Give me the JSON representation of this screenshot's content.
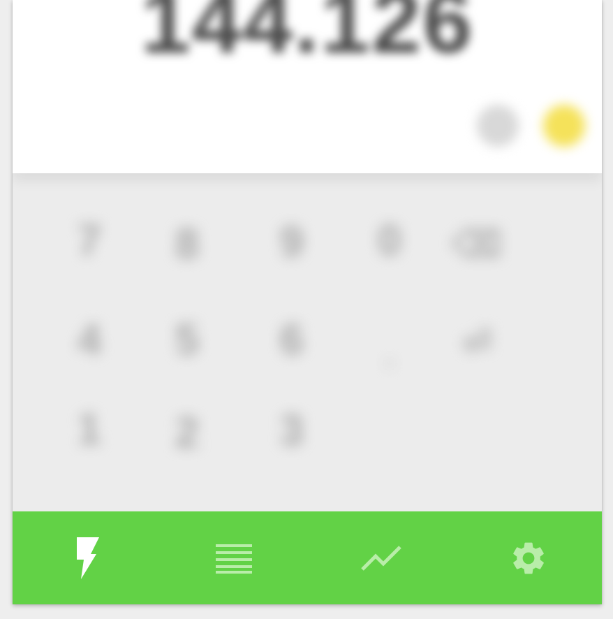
{
  "display": {
    "value": "144.126"
  },
  "keypad": {
    "row1": [
      "7",
      "8",
      "9",
      "0",
      "⌫"
    ],
    "row2": [
      "4",
      "5",
      "6",
      ".",
      "⏎"
    ],
    "row3": [
      "1",
      "2",
      "3"
    ]
  },
  "nav": {
    "items": [
      {
        "icon": "lightning-icon",
        "active": true
      },
      {
        "icon": "list-icon",
        "active": false
      },
      {
        "icon": "chart-icon",
        "active": false
      },
      {
        "icon": "gear-icon",
        "active": false
      }
    ]
  },
  "colors": {
    "accent": "#62d246",
    "nav_active_icon": "#ffffff",
    "nav_inactive_icon": "#b9eda9",
    "secondary_key": "#f5e25a"
  }
}
